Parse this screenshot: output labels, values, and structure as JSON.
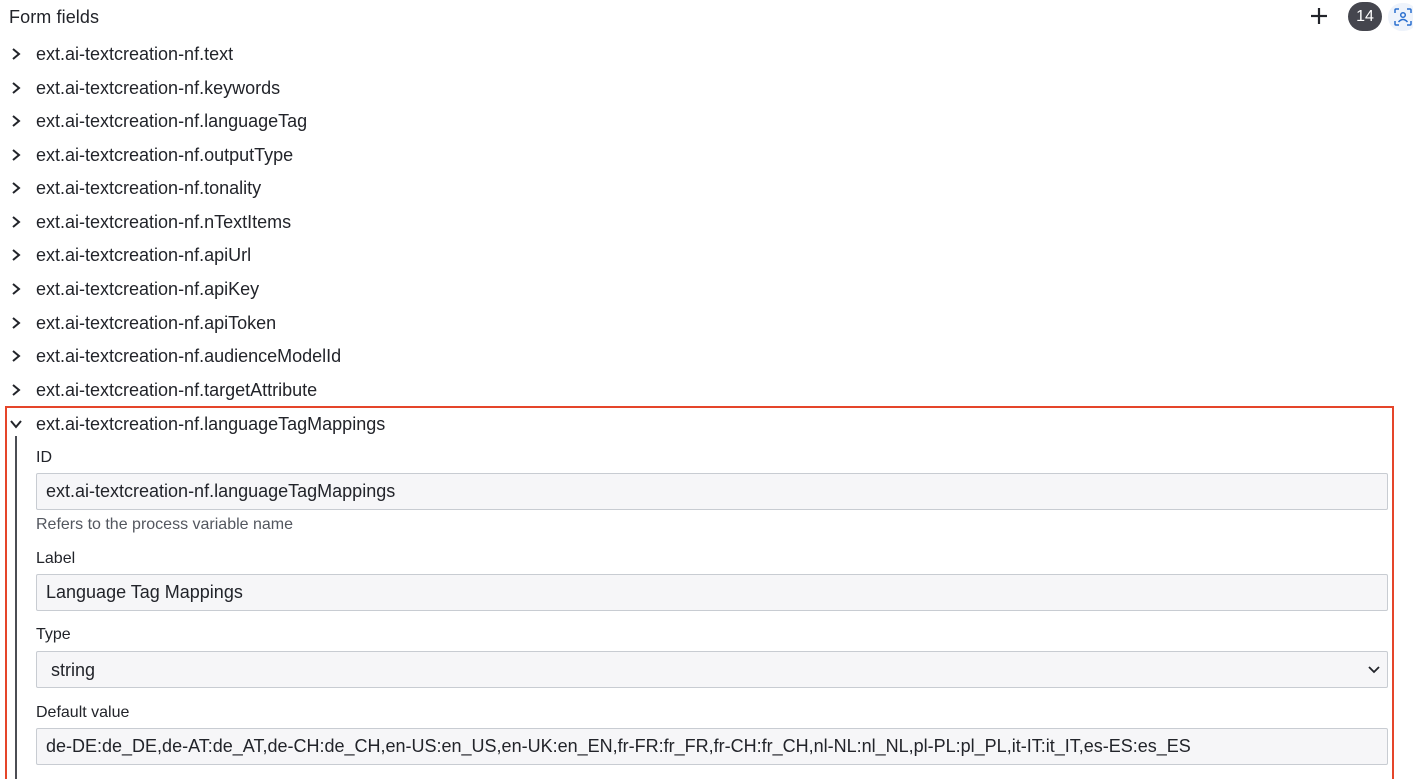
{
  "header": {
    "title": "Form fields",
    "count": "14",
    "add_icon": "plus-icon",
    "focus_icon": "focus-scan-icon"
  },
  "fields": [
    {
      "label": "ext.ai-textcreation-nf.text",
      "expanded": false
    },
    {
      "label": "ext.ai-textcreation-nf.keywords",
      "expanded": false
    },
    {
      "label": "ext.ai-textcreation-nf.languageTag",
      "expanded": false
    },
    {
      "label": "ext.ai-textcreation-nf.outputType",
      "expanded": false
    },
    {
      "label": "ext.ai-textcreation-nf.tonality",
      "expanded": false
    },
    {
      "label": "ext.ai-textcreation-nf.nTextItems",
      "expanded": false
    },
    {
      "label": "ext.ai-textcreation-nf.apiUrl",
      "expanded": false
    },
    {
      "label": "ext.ai-textcreation-nf.apiKey",
      "expanded": false
    },
    {
      "label": "ext.ai-textcreation-nf.apiToken",
      "expanded": false
    },
    {
      "label": "ext.ai-textcreation-nf.audienceModelId",
      "expanded": false
    },
    {
      "label": "ext.ai-textcreation-nf.targetAttribute",
      "expanded": false
    },
    {
      "label": "ext.ai-textcreation-nf.languageTagMappings",
      "expanded": true
    }
  ],
  "details": {
    "id_label": "ID",
    "id_value": "ext.ai-textcreation-nf.languageTagMappings",
    "id_helper": "Refers to the process variable name",
    "label_label": "Label",
    "label_value": "Language Tag Mappings",
    "type_label": "Type",
    "type_value": "string",
    "default_label": "Default value",
    "default_value": "de-DE:de_DE,de-AT:de_AT,de-CH:de_CH,en-US:en_US,en-UK:en_EN,fr-FR:fr_FR,fr-CH:fr_CH,nl-NL:nl_NL,pl-PL:pl_PL,it-IT:it_IT,es-ES:es_ES"
  },
  "colors": {
    "highlight": "#e5452a",
    "badge": "#45464e",
    "text": "#22242a"
  }
}
